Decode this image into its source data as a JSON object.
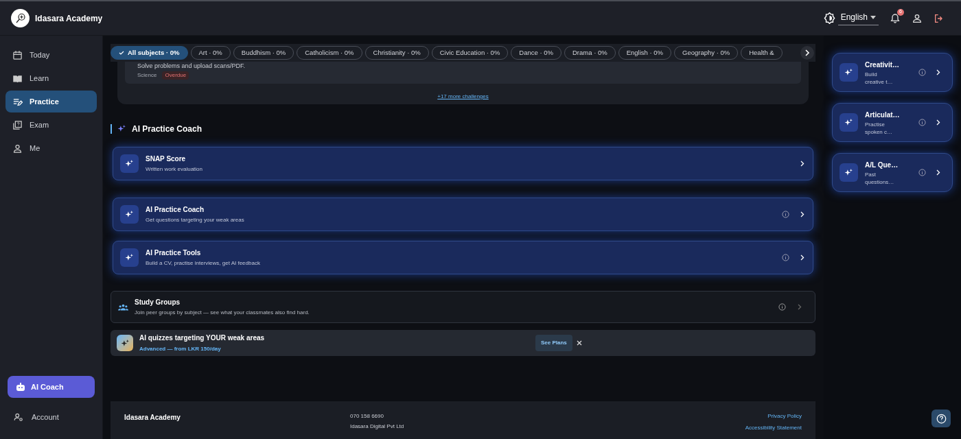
{
  "header": {
    "brand": "Idasara Academy",
    "language": "English",
    "notification_count": "6"
  },
  "sidebar": {
    "items": [
      {
        "label": "Today",
        "selected": false
      },
      {
        "label": "Learn",
        "selected": false
      },
      {
        "label": "Practice",
        "selected": true
      },
      {
        "label": "Exam",
        "selected": false
      },
      {
        "label": "Me",
        "selected": false
      }
    ],
    "ai_coach": "AI Coach",
    "account": "Account"
  },
  "subject_chips": [
    {
      "label": "All subjects · 0%",
      "selected": true
    },
    {
      "label": "Art · 0%",
      "selected": false
    },
    {
      "label": "Buddhism · 0%",
      "selected": false
    },
    {
      "label": "Catholicism · 0%",
      "selected": false
    },
    {
      "label": "Christianity · 0%",
      "selected": false
    },
    {
      "label": "Civic Education · 0%",
      "selected": false
    },
    {
      "label": "Dance · 0%",
      "selected": false
    },
    {
      "label": "Drama · 0%",
      "selected": false
    },
    {
      "label": "English · 0%",
      "selected": false
    },
    {
      "label": "Geography · 0%",
      "selected": false
    },
    {
      "label": "Health &",
      "selected": false
    }
  ],
  "challenge": {
    "description": "Solve problems and upload scans/PDF.",
    "subject": "Science",
    "status": "Overdue"
  },
  "more_link": "+17 more challenges",
  "section_title": "AI Practice Coach",
  "tools": [
    {
      "title": "SNAP Score",
      "subtitle": "Written work evaluation",
      "info": false
    },
    {
      "title": "AI Practice Coach",
      "subtitle": "Get questions targeting your weak areas",
      "info": true
    },
    {
      "title": "AI Practice Tools",
      "subtitle": "Build a CV, practise interviews, get AI feedback",
      "info": true
    }
  ],
  "study_groups": {
    "title": "Study Groups",
    "subtitle": "Join peer groups by subject — see what your classmates also find hard."
  },
  "promo": {
    "title": "AI quizzes targeting YOUR weak areas",
    "subtitle": "Advanced — from LKR 150/day",
    "button": "See Plans"
  },
  "footer": {
    "brand": "Idasara Academy",
    "phone": "070 158 6690",
    "company": "Idasara Digital Pvt Ltd",
    "links": [
      "Privacy Policy",
      "Accessibility Statement"
    ]
  },
  "side_tools": [
    {
      "title": "Creativit…",
      "subtitle": "Build creative t…"
    },
    {
      "title": "Articulat…",
      "subtitle": "Practise spoken c…"
    },
    {
      "title": "A/L Que…",
      "subtitle": "Past questions…"
    }
  ]
}
